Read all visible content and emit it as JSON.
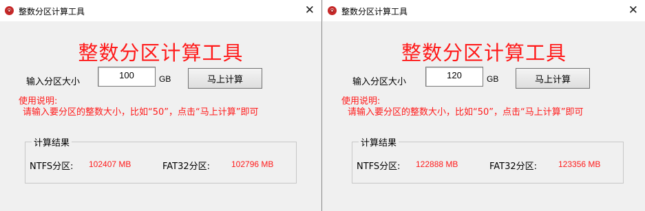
{
  "windows": [
    {
      "title": "整数分区计算工具",
      "heading": "整数分区计算工具",
      "input_label": "输入分区大小",
      "input_value": "100",
      "unit": "GB",
      "button_label": "马上计算",
      "usage_title": "使用说明:",
      "usage_text": "请输入要分区的整数大小，比如“50”，点击“马上计算”即可",
      "result_legend": "计算结果",
      "ntfs_label": "NTFS分区:",
      "ntfs_value": "102407 MB",
      "fat32_label": "FAT32分区:",
      "fat32_value": "102796 MB"
    },
    {
      "title": "整数分区计算工具",
      "heading": "整数分区计算工具",
      "input_label": "输入分区大小",
      "input_value": "120",
      "unit": "GB",
      "button_label": "马上计算",
      "usage_title": "使用说明:",
      "usage_text": "请输入要分区的整数大小，比如“50”，点击“马上计算”即可",
      "result_legend": "计算结果",
      "ntfs_label": "NTFS分区:",
      "ntfs_value": "122888 MB",
      "fat32_label": "FAT32分区:",
      "fat32_value": "123356 MB"
    }
  ],
  "colors": {
    "accent_red": "#ff1a1a",
    "window_bg": "#f0f0f0",
    "titlebar_bg": "#ffffff"
  },
  "icons": {
    "app": "app-logo-icon",
    "close": "close-icon"
  }
}
